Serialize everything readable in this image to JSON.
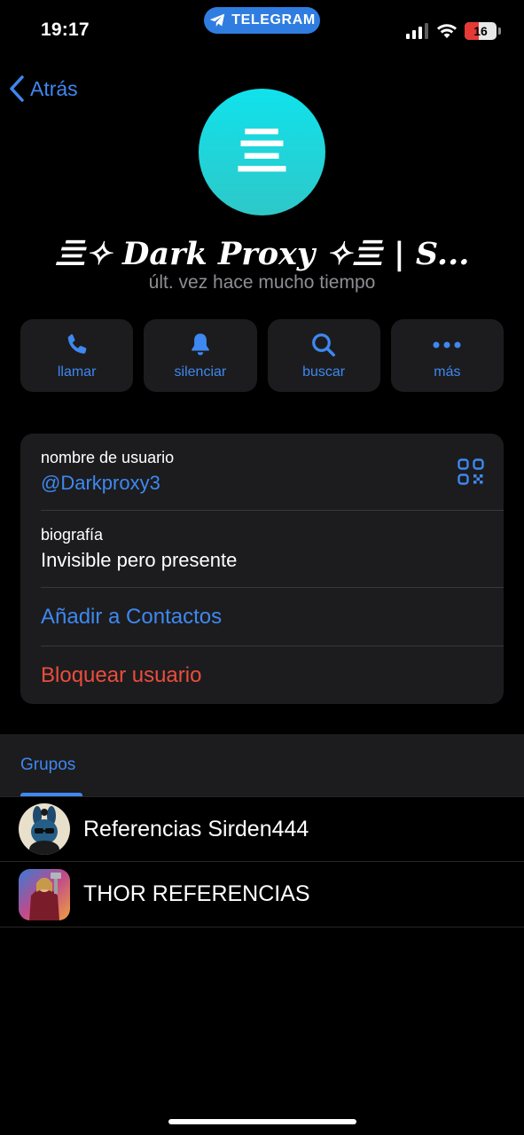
{
  "status_bar": {
    "time": "19:17",
    "app_pill": "TELEGRAM",
    "battery": "16"
  },
  "nav": {
    "back_label": "Atrás"
  },
  "profile": {
    "avatar_glyph": "亖",
    "name": "亖✧ 𝑫𝒂𝒓𝒌 𝑷𝒓𝒐𝒙𝒚 ✧亖 | S...",
    "status": "últ. vez hace mucho tiempo"
  },
  "actions": [
    {
      "label": "llamar",
      "icon": "phone-icon"
    },
    {
      "label": "silenciar",
      "icon": "bell-icon"
    },
    {
      "label": "buscar",
      "icon": "search-icon"
    },
    {
      "label": "más",
      "icon": "more-icon"
    }
  ],
  "info": {
    "username_caption": "nombre de usuario",
    "username": "@Darkproxy3",
    "bio_caption": "biografía",
    "bio": "Invisible pero presente",
    "add_contact": "Añadir a Contactos",
    "block_user": "Bloquear usuario"
  },
  "groups": {
    "tab_label": "Grupos",
    "items": [
      {
        "name": "Referencias Sirden444"
      },
      {
        "name": "THOR REFERENCIAS"
      }
    ]
  },
  "colors": {
    "accent": "#3e88f0",
    "destructive": "#eb4d3d",
    "card": "#1c1c1e",
    "avatar_gradient_top": "#10e2ec"
  }
}
